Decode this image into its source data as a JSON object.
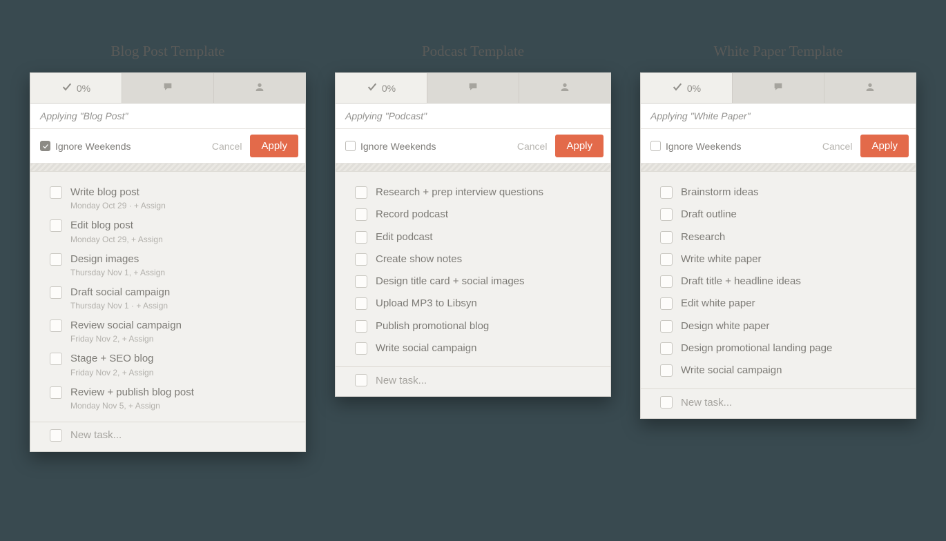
{
  "panels": [
    {
      "title": "Blog Post Template",
      "progress": "0%",
      "applying": "Applying \"Blog Post\"",
      "ignore_weekends_label": "Ignore Weekends",
      "ignore_weekends_checked": true,
      "cancel_label": "Cancel",
      "apply_label": "Apply",
      "tasks": [
        {
          "title": "Write blog post",
          "meta": "Monday Oct 29 ·  + Assign"
        },
        {
          "title": "Edit blog post",
          "meta": "Monday Oct 29,  + Assign"
        },
        {
          "title": "Design images",
          "meta": "Thursday Nov 1,  + Assign"
        },
        {
          "title": "Draft social campaign",
          "meta": "Thursday Nov 1 ·  + Assign"
        },
        {
          "title": "Review social campaign",
          "meta": "Friday Nov 2,  + Assign"
        },
        {
          "title": "Stage + SEO blog",
          "meta": "Friday Nov 2,  + Assign"
        },
        {
          "title": "Review + publish blog post",
          "meta": "Monday Nov 5,  + Assign"
        }
      ],
      "new_task_label": "New task..."
    },
    {
      "title": "Podcast Template",
      "progress": "0%",
      "applying": "Applying \"Podcast\"",
      "ignore_weekends_label": "Ignore Weekends",
      "ignore_weekends_checked": false,
      "cancel_label": "Cancel",
      "apply_label": "Apply",
      "tasks": [
        {
          "title": "Research + prep interview questions"
        },
        {
          "title": "Record podcast"
        },
        {
          "title": "Edit podcast"
        },
        {
          "title": "Create show notes"
        },
        {
          "title": "Design title card + social images"
        },
        {
          "title": "Upload MP3 to Libsyn"
        },
        {
          "title": "Publish promotional blog"
        },
        {
          "title": "Write social campaign"
        }
      ],
      "new_task_label": "New task..."
    },
    {
      "title": "White Paper Template",
      "progress": "0%",
      "applying": "Applying \"White Paper\"",
      "ignore_weekends_label": "Ignore Weekends",
      "ignore_weekends_checked": false,
      "cancel_label": "Cancel",
      "apply_label": "Apply",
      "tasks": [
        {
          "title": "Brainstorm ideas"
        },
        {
          "title": "Draft outline"
        },
        {
          "title": "Research"
        },
        {
          "title": "Write white paper"
        },
        {
          "title": "Draft title + headline ideas"
        },
        {
          "title": "Edit white paper"
        },
        {
          "title": "Design white paper"
        },
        {
          "title": "Design promotional landing page"
        },
        {
          "title": "Write social campaign"
        }
      ],
      "new_task_label": "New task..."
    }
  ]
}
